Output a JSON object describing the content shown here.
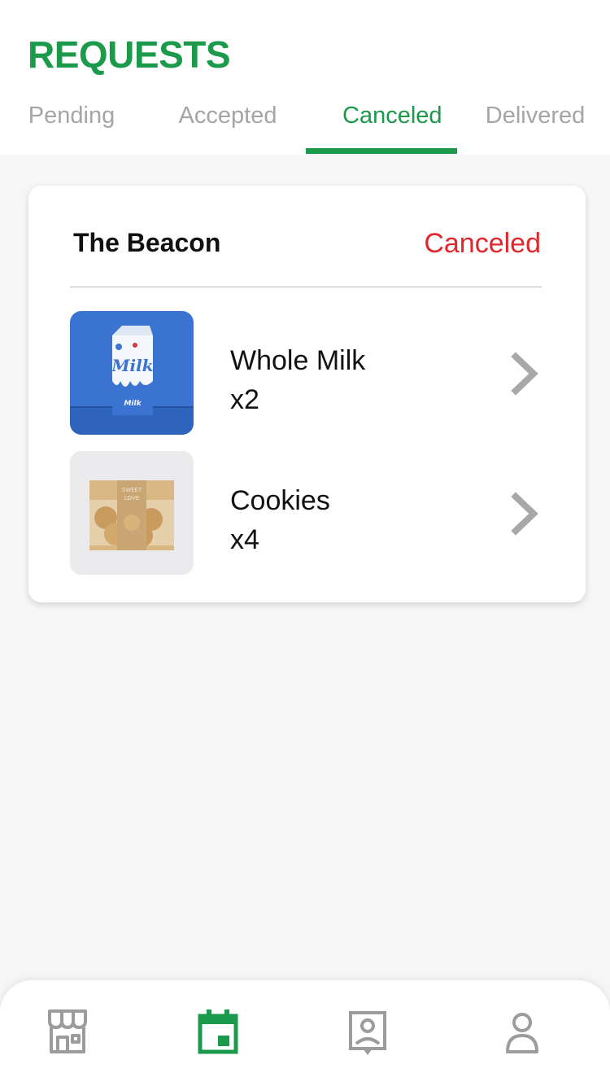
{
  "header": {
    "title": "REQUESTS"
  },
  "tabs": [
    {
      "label": "Pending"
    },
    {
      "label": "Accepted"
    },
    {
      "label": "Canceled",
      "active": true
    },
    {
      "label": "Delivered"
    }
  ],
  "order": {
    "store_name": "The Beacon",
    "status": "Canceled",
    "items": [
      {
        "name": "Whole Milk",
        "qty": "x2",
        "image_icon": "milk-carton-photo"
      },
      {
        "name": "Cookies",
        "qty": "x4",
        "image_icon": "cookies-bag-photo"
      }
    ]
  },
  "bottom_nav": [
    {
      "icon": "store-icon",
      "active": false
    },
    {
      "icon": "calendar-icon",
      "active": true
    },
    {
      "icon": "profile-card-icon",
      "active": false
    },
    {
      "icon": "person-icon",
      "active": false
    }
  ],
  "colors": {
    "accent": "#1a9a4a",
    "inactive": "#a5a5a5",
    "canceled": "#e2262b",
    "nav_inactive": "#9c9c9c"
  }
}
